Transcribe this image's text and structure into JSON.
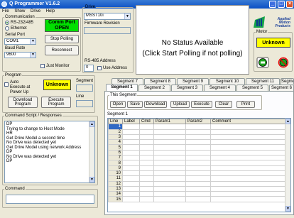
{
  "window": {
    "title": "Q Programmer V1.6.2",
    "min": "_",
    "max": "□",
    "close": "×"
  },
  "menu": [
    "File",
    "Show",
    "Drive",
    "Help"
  ],
  "communication": {
    "legend": "Communication",
    "rs232": "RS-232/485",
    "ethernet": "Ethernet",
    "status": "Comm Port OPEN",
    "serial_port_label": "Serial Port",
    "serial_port_value": "COM1",
    "stop_polling": "Stop Polling",
    "baud_label": "Baud Rate",
    "baud_value": "9600",
    "reconnect": "Reconnect",
    "just_monitor": "Just Monitor"
  },
  "drive": {
    "legend": "Drive",
    "model": "MSST10i",
    "firmware_label": "Firmware Revision",
    "firmware_value": "",
    "rs485_label": "RS-485 Address",
    "rs485_value": "0",
    "use_address": "Use Address"
  },
  "status_panel": {
    "line1": "No Status Available",
    "line2": "(Click Start Polling if not polling)"
  },
  "logo": {
    "name": "Applied Motion Products"
  },
  "motor": {
    "legend": "Motor",
    "status": "Unknown",
    "enable_icon": "motor-enable-icon",
    "disable_icon": "motor-disable-icon"
  },
  "program": {
    "legend": "Program",
    "auto_execute": "Auto Execute at Power Up",
    "status": "Unknown",
    "segment_label": "Segment",
    "line_label": "Line",
    "download": "Download Program",
    "execute": "Execute Program"
  },
  "script": {
    "legend": "Command Script / Responses",
    "lines": [
      "DP",
      "Trying to change to Host Mode",
      "HR",
      "Get Drive Model a second time",
      "No Drive was detected yet",
      "Get Drive Model using network Address",
      "DP",
      "No Drive was detected yet",
      "DP"
    ]
  },
  "command": {
    "legend": "Command",
    "value": ""
  },
  "tabs_row1": [
    "Segment 7",
    "Segment 8",
    "Segment 9",
    "Segment 10",
    "Segment 11",
    "Segment 12"
  ],
  "tabs_row2": [
    "Segment 1",
    "Segment 2",
    "Segment 3",
    "Segment 4",
    "Segment 5",
    "Segment 6"
  ],
  "segment": {
    "legend": "This Segment",
    "open": "Open",
    "save": "Save",
    "download": "Download",
    "upload": "Upload",
    "execute": "Execute",
    "clear": "Clear",
    "print": "Print",
    "grid_title": "Segment 1"
  },
  "grid": {
    "columns": [
      "Line",
      "Label",
      "Cmd",
      "Param1",
      "Param2",
      "Comment"
    ],
    "rows": [
      "1",
      "2",
      "3",
      "4",
      "5",
      "6",
      "7",
      "8",
      "9",
      "10",
      "11",
      "12",
      "13",
      "14",
      "15"
    ]
  }
}
